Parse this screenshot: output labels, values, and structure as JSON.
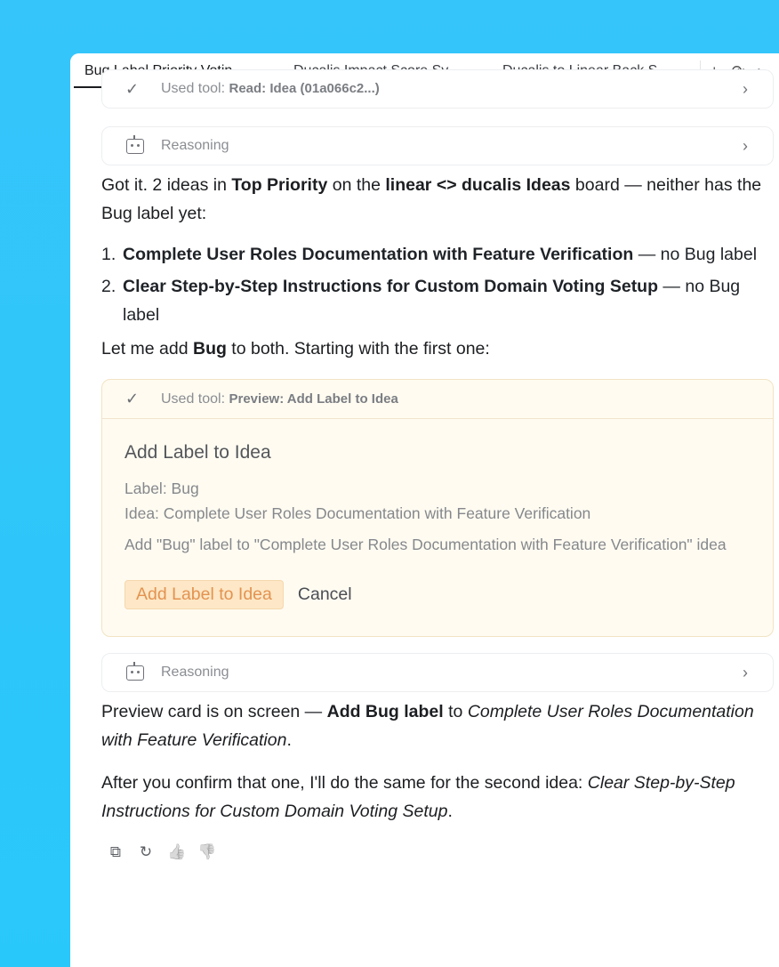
{
  "tabs": [
    {
      "label": "Bug Label Priority Votin..."
    },
    {
      "label": "Ducalis Impact Score Sy..."
    },
    {
      "label": "Ducalis to Linear Back S..."
    }
  ],
  "tab_actions": {
    "add": "+",
    "history": "⟳",
    "more": "›"
  },
  "tool_read": {
    "prefix": "Used tool:",
    "name": "Read: Idea (01a066c2...)"
  },
  "reasoning_1": {
    "label": "Reasoning"
  },
  "intro": {
    "t1": "Got it. 2 ideas in ",
    "b1": "Top Priority",
    "t2": " on the ",
    "b2": "linear <> ducalis Ideas",
    "t3": " board — neither has the Bug label yet:"
  },
  "ideas": [
    {
      "num": "1.",
      "title": "Complete User Roles Documentation with Feature Verification",
      "suffix": " — no Bug label"
    },
    {
      "num": "2.",
      "title": "Clear Step-by-Step Instructions for Custom Domain Voting Setup",
      "suffix": " — no Bug label"
    }
  ],
  "add_msg": {
    "t1": "Let me add ",
    "b1": "Bug",
    "t2": " to both. Starting with the first one:"
  },
  "preview": {
    "prefix": "Used tool:",
    "name": "Preview: Add Label to Idea",
    "title": "Add Label to Idea",
    "label_line": "Label: Bug",
    "idea_line": "Idea: Complete User Roles Documentation with Feature Verification",
    "description": "Add \"Bug\" label to \"Complete User Roles Documentation with Feature Verification\" idea",
    "confirm": "Add Label to Idea",
    "cancel": "Cancel"
  },
  "reasoning_2": {
    "label": "Reasoning"
  },
  "preview_msg": {
    "t1": "Preview card is on screen — ",
    "b1": "Add Bug label",
    "t2": " to ",
    "i1": "Complete User Roles Documentation with Feature Verification",
    "t3": "."
  },
  "final_msg": {
    "t1": "After you confirm that one, I'll do the same for the second idea: ",
    "i1": "Clear Step-by-Step Instructions for Custom Domain Voting Setup",
    "t2": "."
  },
  "icons": {
    "check": "✓",
    "chevron": "›",
    "copy": "⧉",
    "retry": "↻",
    "up": "👍",
    "down": "👎"
  }
}
